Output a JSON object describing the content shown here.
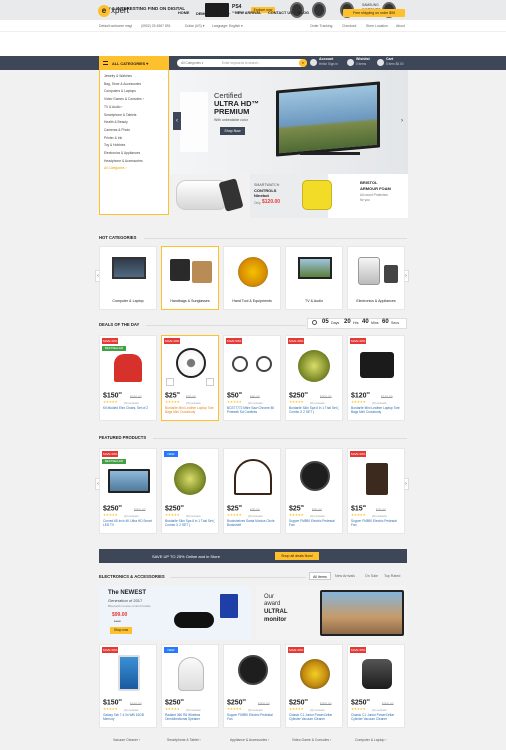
{
  "top_banner": {
    "text": "NEW & INTERESTING FIND ON DIGITAL",
    "ps4_label": "PS4",
    "ps4_sub": "Graphics",
    "explore_label": "Explore now",
    "watch_text_1": "SAMSUNG",
    "watch_text_2": "WATCHES",
    "watch_text_3": "Gear S2"
  },
  "util_bar": {
    "welcome": "Default welcome msg!",
    "phone": "(0902) 25 4567 891",
    "currency": "Dollar (US) ▾",
    "language": "Language: English ▾",
    "links": [
      "Order Tracking",
      "Checkout",
      "Store Location",
      "About"
    ]
  },
  "header": {
    "logo_letter": "e",
    "logo_text": "xpert",
    "nav": [
      "HOME",
      "DEMOS ▾",
      "DEAL",
      "NEW ARRIVAL",
      "CONTACT US",
      "BLOG"
    ],
    "shipping": "Free shipping on order $99"
  },
  "search_bar": {
    "all_categories": "ALL CATEGORIES ▾",
    "category_select": "All Categories ▾",
    "placeholder": "Enter keywords to search...",
    "account_title": "Account",
    "account_sub": "Hello! Sign in",
    "wishlist_title": "Wishlist",
    "wishlist_sub": "0 items",
    "cart_title": "Cart",
    "cart_sub": "0 item $0.00"
  },
  "categories": [
    "Jewelry & Watches",
    "Bag, Shoe & Accessories",
    "Computers & Laptops",
    "Video Games & Consoles ›",
    "TV & Audio ›",
    "Smartphone & Tablets",
    "Health & Beauty",
    "Cameras & Photo",
    "Printer & Ink",
    "Toy & Hobbies",
    "Electronics & Appliances",
    "Headphone & Accessories",
    "All Categories ›"
  ],
  "hero": {
    "certified": "Certified",
    "ultra": "ULTRA HD™",
    "premium": "PREMIUM",
    "sub": "With unbeatable color",
    "btn": "Shop Now"
  },
  "sub_banners": {
    "b2_title_1": "SMARTWATCH",
    "b2_title_2": "CONTROLS",
    "b2_title_3": "Ninebot",
    "b2_price_label": "Only",
    "b2_price": "$120.00",
    "b3_title_1": "BRISTOL",
    "b3_title_2": "ARMOUR FOAM",
    "b3_sub_1": "All-round Protection",
    "b3_sub_2": "for you"
  },
  "hot_categories": {
    "title": "HOT CATEGORIES",
    "items": [
      "Computer & Laptop",
      "Handbags & Sunglasses",
      "Hand Tool & Equipments",
      "TV & Audio",
      "Electronics & Appliances"
    ]
  },
  "deals": {
    "title": "DEALS OF THE DAY",
    "countdown": {
      "days": "05",
      "days_lbl": "Days",
      "hours": "20",
      "hours_lbl": "Hrs",
      "mins": "40",
      "mins_lbl": "Mins",
      "secs": "60",
      "secs_lbl": "Secs"
    },
    "products": [
      {
        "badge": "SAVE 30%",
        "best": "BESTSELLER",
        "price": "$150",
        "cents": "00",
        "old": "$160.00",
        "reviews": "(0) reviews",
        "name": "Kit Molded Eiex Chairs, Set of 2"
      },
      {
        "badge": "SAVE 30%",
        "price": "$25",
        "cents": "00",
        "old": "$30.00",
        "reviews": "(0) reviews",
        "name": "Burdarile Mini Leather Laptop Tote Bags Mini Crossbody"
      },
      {
        "badge": "SAVE 50%",
        "price": "$50",
        "cents": "00",
        "old": "$60.00",
        "reviews": "(0) reviews",
        "name": "BCS77772 Mitre Saw Chrome 80 Pinewell Sd Cordless"
      },
      {
        "badge": "SAVE 30%",
        "price": "$250",
        "cents": "00",
        "old": "$300.00",
        "reviews": "(0) reviews",
        "name": "Burdarile Skin Spa 6 in 1 Trial Set ( Combo X 2 SET )"
      },
      {
        "badge": "SAVE 30%",
        "price": "$120",
        "cents": "00",
        "old": "$130.00",
        "reviews": "(0) reviews",
        "name": "Burdarile Mini Leather Laptop Tote Bags Mini Crossbody"
      }
    ]
  },
  "featured": {
    "title": "FEATURED PRODUCTS",
    "products": [
      {
        "badge": "SAVE 30%",
        "best": "BESTSELLER",
        "price": "$250",
        "cents": "00",
        "old": "$300.00",
        "reviews": "(0) reviews",
        "name": "Curved 65 Inch 4K Ultra HD Smart LED TV"
      },
      {
        "badge": "NEW",
        "price": "$250",
        "cents": "00",
        "old": "",
        "reviews": "(0) reviews",
        "name": "Burdarile Skin Spa 6 in 1 Trial Set ( Combo X 2 SET )"
      },
      {
        "badge": "",
        "price": "$25",
        "cents": "00",
        "old": "$30.00",
        "reviews": "(0) reviews",
        "name": "Bookshelves Santa Monica Circle Bookshelf"
      },
      {
        "badge": "",
        "price": "$25",
        "cents": "00",
        "old": "$30.00",
        "reviews": "(0) reviews",
        "name": "Supper FM890 Electric Pedestal Fan"
      },
      {
        "badge": "SAVE 30%",
        "price": "$15",
        "cents": "99",
        "old": "$20.00",
        "reviews": "(0) reviews",
        "name": "Supper FM890 Electric Pedestal Fan"
      }
    ]
  },
  "promo": {
    "text": "SAVE UP TO 25% Online and in Store",
    "btn": "Shop all deals Now!"
  },
  "electronics": {
    "title": "ELECTRONICS & ACCESSORIES",
    "tabs": [
      "All Items",
      "New Arrivals",
      "On Sale",
      "Top Rated"
    ],
    "banner1_title": "The NEWEST",
    "banner1_sub": "Generation of 2017",
    "banner1_desc": "Bluetooth remote control handle",
    "banner1_price": "$99.00",
    "banner1_old": "$109",
    "banner1_btn": "Shop now",
    "banner2_our": "Our",
    "banner2_award": "award",
    "banner2_ultral": "ULTRAL",
    "banner2_monitor": "monitor",
    "products": [
      {
        "badge": "SAVE 30%",
        "price": "$150",
        "cents": "00",
        "old": "$160.00",
        "reviews": "(0) reviews",
        "name": "Galaxy Tab 7 4.0n Wifi 16GB Memory"
      },
      {
        "badge": "NEW",
        "price": "$250",
        "cents": "00",
        "old": "",
        "reviews": "(0) reviews",
        "name": "Radiant 360 R6 Wireless Omnidirectional Speaker"
      },
      {
        "badge": "",
        "price": "$250",
        "cents": "00",
        "old": "$300.00",
        "reviews": "(0) reviews",
        "name": "Supper FM890 Electric Pedestal Fan"
      },
      {
        "badge": "SAVE 30%",
        "price": "$250",
        "cents": "00",
        "old": "$300.00",
        "reviews": "(0) reviews",
        "name": "Classic C1 Junior PowerCellar Cylinder Vacuum Cleaner"
      },
      {
        "badge": "SAVE 30%",
        "price": "$250",
        "cents": "00",
        "old": "$300.00",
        "reviews": "(0) reviews",
        "name": "Classic C1 Junior PowerCellar Cylinder Vacuum Cleaner"
      }
    ],
    "footer_cats": [
      "Vacuum Cleaner ›",
      "Smartphone & Tablet ›",
      "Appliance & Accessories ›",
      "Video Game & Consoles ›",
      "Computer & Laptop ›"
    ]
  },
  "colors": {
    "accent": "#fec02c",
    "dark": "#3d4758",
    "sale": "#e53935",
    "new": "#2979ff",
    "best": "#43a047",
    "link": "#2b6cb0"
  }
}
